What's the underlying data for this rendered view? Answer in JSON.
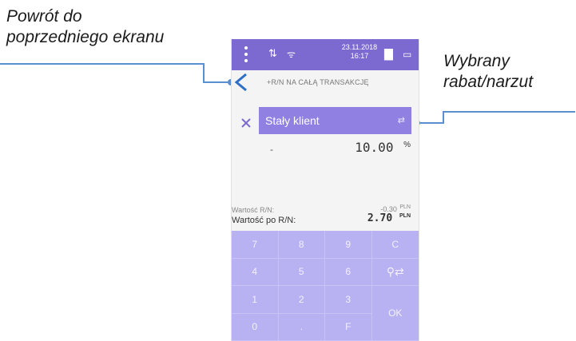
{
  "annotations": {
    "back": [
      "Powrót do",
      "poprzedniego ekranu"
    ],
    "selected": [
      "Wybrany",
      "rabat/narzut"
    ]
  },
  "status_bar": {
    "date": "23.11.2018",
    "time": "16:17",
    "icons": [
      "menu-icon",
      "signal-icon",
      "wifi-icon",
      "printer-icon",
      "battery-icon",
      "cart-icon"
    ]
  },
  "screen": {
    "transaction_label": "+R/N NA CAŁĄ TRANSAKCJĘ",
    "selected_discount": "Stały klient",
    "dash": "-",
    "value": "10.00",
    "percent": "%",
    "rn_label": "Wartość R/N:",
    "rn_value": "-0.30",
    "rn_unit": "PLN",
    "after_label": "Wartość po R/N:",
    "after_value": "2.70",
    "after_unit": "PLN"
  },
  "keypad": {
    "keys": [
      "7",
      "8",
      "9",
      "C",
      "4",
      "5",
      "6",
      "",
      "1",
      "2",
      "3",
      "OK",
      "0",
      ".",
      "F"
    ]
  },
  "colors": {
    "accent": "#7c6ad0",
    "selected": "#8f80e2",
    "keypad": "#b8b1f2",
    "leader": "#5b8fd0"
  }
}
